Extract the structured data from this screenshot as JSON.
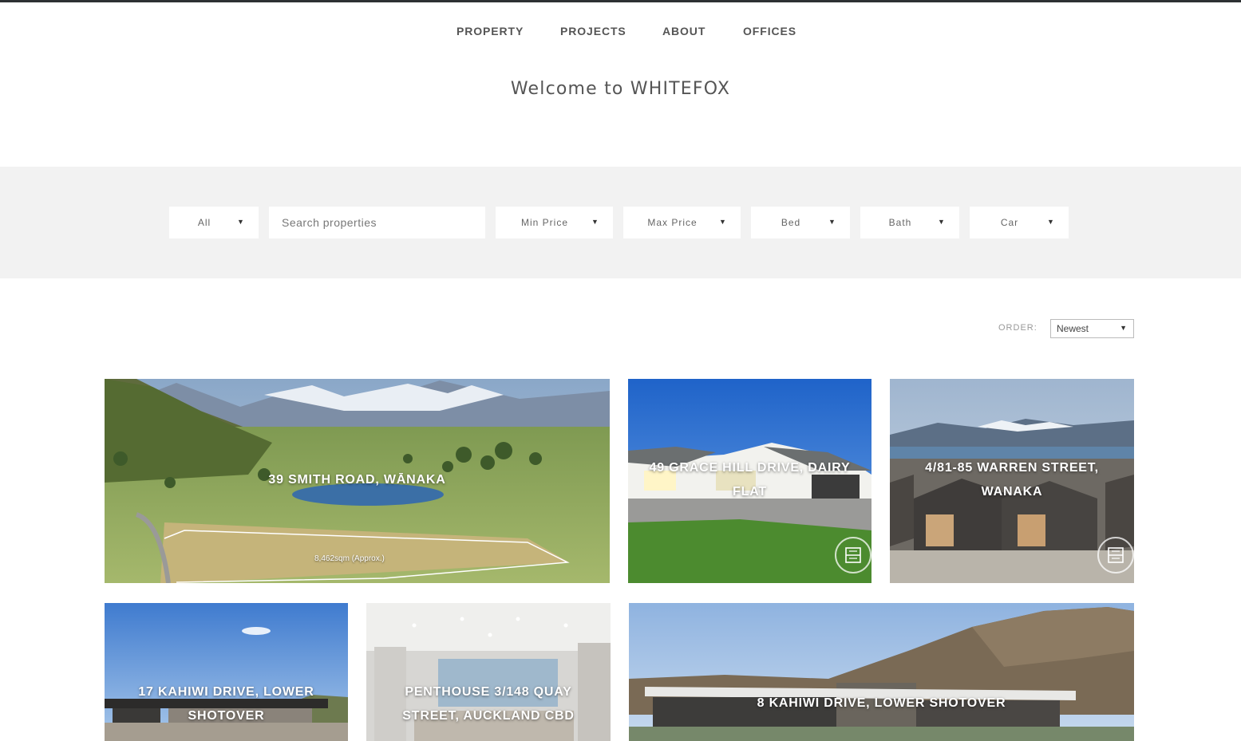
{
  "nav": {
    "items": [
      "PROPERTY",
      "PROJECTS",
      "ABOUT",
      "OFFICES"
    ]
  },
  "welcome": "Welcome to WHITEFOX",
  "filters": {
    "type": "All",
    "search_placeholder": "Search properties",
    "min_price": "Min Price",
    "max_price": "Max Price",
    "bed": "Bed",
    "bath": "Bath",
    "car": "Car"
  },
  "order": {
    "label": "ORDER:",
    "value": "Newest"
  },
  "listings": [
    {
      "address": "39 SMITH ROAD, WĀNAKA",
      "caption": "8,462sqm (Approx.)"
    },
    {
      "address": "49 GRACE HILL DRIVE, DAIRY FLAT"
    },
    {
      "address": "4/81-85 WARREN STREET, WANAKA"
    },
    {
      "address": "17 KAHIWI DRIVE, LOWER SHOTOVER"
    },
    {
      "address": "PENTHOUSE 3/148 QUAY STREET, AUCKLAND CBD"
    },
    {
      "address": "8 KAHIWI DRIVE, LOWER SHOTOVER"
    }
  ],
  "icons": {
    "floorplan": "floorplan-icon",
    "dropdown": "chevron-down-icon"
  },
  "colors": {
    "topline": "#2d3133",
    "filter_band": "#f2f2f2",
    "text": "#555555"
  }
}
